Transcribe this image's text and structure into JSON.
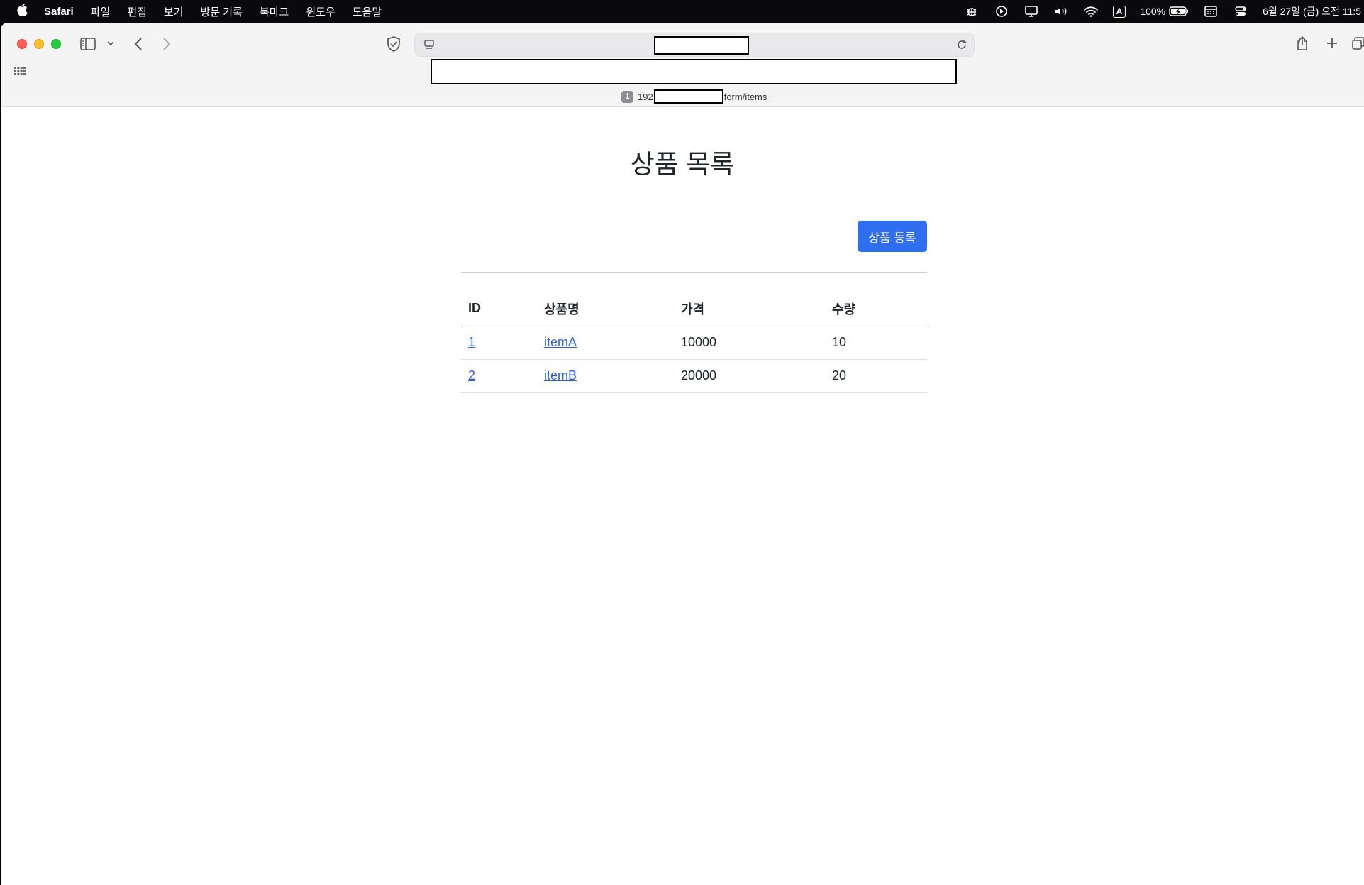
{
  "menubar": {
    "apple_icon": "apple-logo",
    "items": [
      "Safari",
      "파일",
      "편집",
      "보기",
      "방문 기록",
      "북마크",
      "윈도우",
      "도움말"
    ],
    "status_icons": [
      "bug-icon",
      "play-circle-icon",
      "display-icon",
      "volume-icon",
      "wifi-icon"
    ],
    "input_lang": "A",
    "battery_text": "100%",
    "clock": "6월 27일 (금) 오전 11:5"
  },
  "browser": {
    "tab_hover": {
      "badge": "1",
      "url_prefix": "192",
      "url_suffix": "form/items"
    }
  },
  "page": {
    "title": "상품 목록",
    "register_button": "상품 등록",
    "table": {
      "headers": [
        "ID",
        "상품명",
        "가격",
        "수량"
      ],
      "rows": [
        [
          "1",
          "itemA",
          "10000",
          "10"
        ],
        [
          "2",
          "itemB",
          "20000",
          "20"
        ]
      ]
    }
  },
  "colors": {
    "primary_button": "#2f6fef",
    "link": "#2f5fd6"
  }
}
